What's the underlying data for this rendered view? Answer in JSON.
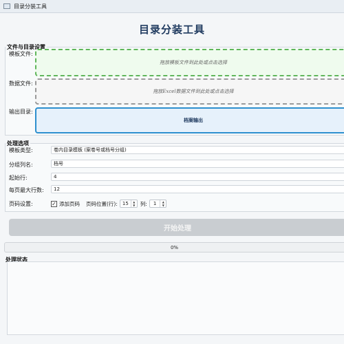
{
  "window": {
    "title": "目录分装工具"
  },
  "header": {
    "title": "目录分装工具"
  },
  "files_group": {
    "title": "文件与目录设置",
    "template_label": "模板文件:",
    "template_hint": "拖放模板文件到此处或点击选择",
    "data_label": "数据文件:",
    "data_hint": "拖放Excel数据文件到此处或点击选择",
    "output_label": "输出目录:",
    "output_value": "档案输出"
  },
  "options_group": {
    "title": "处理选项",
    "template_type_label": "模板类型:",
    "template_type_value": "卷内目录模板 (案卷号或档号分组)",
    "group_col_label": "分组列名:",
    "group_col_value": "档号",
    "start_row_label": "起始行:",
    "start_row_value": "4",
    "max_rows_label": "每页最大行数:",
    "max_rows_value": "12",
    "page_label": "页码设置:",
    "add_page_label": "添加页码",
    "add_page_checked": true,
    "page_pos_label": "页码位置(行):",
    "page_pos_value": "15",
    "col_label": "列:",
    "col_value": "1"
  },
  "actions": {
    "start_label": "开始处理"
  },
  "progress": {
    "text": "0%",
    "fraction": 0
  },
  "status_group": {
    "title": "处理状态"
  }
}
